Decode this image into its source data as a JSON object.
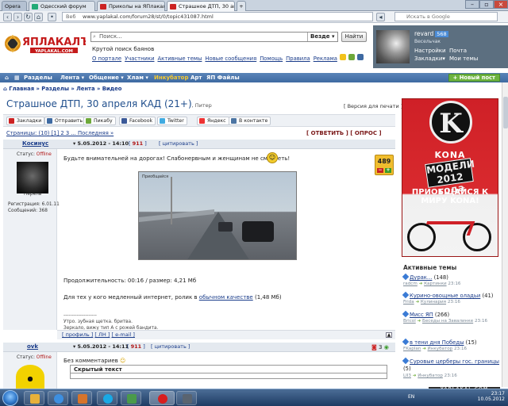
{
  "browser": {
    "tabs": [
      {
        "label": "Opera",
        "color": "#d22"
      },
      {
        "label": "Одесский форум",
        "color": "#2a7"
      },
      {
        "label": "Приколы на ЯПлакалъ",
        "color": "#c22"
      },
      {
        "label": "Страшное ДТП, 30 апреля К",
        "color": "#c22"
      }
    ],
    "address_prefix": "Веб",
    "url": "www.yaplakal.com/forum28/st/0/topic431087.html",
    "search_placeholder": "Искать в Google"
  },
  "header": {
    "logo_text": "ЯПЛАКАЛЪ",
    "logo_sub": "YAPLAKAL.COM",
    "search_placeholder": "Поиск...",
    "search_scope": "Везде",
    "search_button": "Найти",
    "tagline": "Крутой поиск баянов",
    "links": [
      "О портале",
      "Участники",
      "Активные темы",
      "Новые сообщения",
      "Помощь",
      "Правила",
      "Реклама"
    ]
  },
  "user": {
    "name": "revard",
    "score": "568",
    "role": "Весельчак",
    "links": [
      "Настройки",
      "Почта",
      "Закладки",
      "Мои темы"
    ]
  },
  "nav": {
    "items": [
      "Разделы",
      "Лента",
      "Общение",
      "Хлам",
      "Инкубатор",
      "Арт",
      "ЯП Файлы"
    ],
    "new_post": "Новый пост"
  },
  "breadcrumb": [
    "Главная",
    "Разделы",
    "Лента",
    "Видео"
  ],
  "topic": {
    "title": "Страшное ДТП, 30 апреля КАД (21+)",
    "subtitle": ", Питер",
    "print_version": "[ Версия для печати ]",
    "share": [
      "Закладки",
      "Отправить",
      "Пикабу",
      "Facebook",
      "Twitter",
      "Яндекс",
      "В контакте"
    ],
    "pages_label": "Страницы: (10) [1] 2 3 ... Последняя »",
    "pages_links": "[ ОТВЕТИТЬ ] [ ОПРОС ]"
  },
  "post1": {
    "author": "Косинус",
    "date": "5.05.2012 - 14:10",
    "id": "911",
    "quote": "[ цитировать ]",
    "status_label": "Статус:",
    "status": "Offline",
    "user_title": "Перель",
    "reg": "Регистрация: 6.01.11",
    "msgs": "Сообщений: 368",
    "text": "Будьте внимательней на дорогах! Слабонервным и женщинам не смотреть!",
    "rating": "489",
    "video_stamp": "Приобщайся",
    "video_info": "Продолжительность: 00:16 / размер: 4,21 Мб",
    "slow_prefix": "Для тех у кого медленный интернет, ролик в ",
    "slow_link": "обычном качестве",
    "slow_suffix": " (1,48 Мб)",
    "sig_line1": "--------------------",
    "sig_line2": "Утро. зубная щетка. бритва.",
    "sig_line3": "Зеркало, вижу тип А с рожей бандита.",
    "footer": [
      "[ профиль ]",
      "[ ЛН ]",
      "[ e-mail ]"
    ]
  },
  "post2": {
    "author": "ovk",
    "date": "5.05.2012 - 14:11",
    "id": "911",
    "quote": "[ цитировать ]",
    "status_label": "Статус:",
    "status": "Offline",
    "text": "Без комментариев",
    "spoiler": "Скрытый текст",
    "count": "3"
  },
  "ad": {
    "brand": "KONA",
    "year": "МОДЕЛИ 2012 года",
    "slogan": "ПРИОБЩАЙСЯ К МИРУ KONA!"
  },
  "active_topics": {
    "title": "Активные темы",
    "items": [
      {
        "name": "Дурак...",
        "count": "(148)",
        "from": "radcm",
        "to": "Картинки",
        "time": "23:16"
      },
      {
        "name": "Курино-овощные оладьи",
        "count": "(41)",
        "from": "Frida",
        "to": "Кулинария",
        "time": "23:16"
      },
      {
        "name": "Мисс ЯП",
        "count": "(266)",
        "from": "Bricol",
        "to": "Беседы на Завалинке",
        "time": "23:16"
      },
      {
        "name": "в тени дня Победы",
        "count": "(15)",
        "from": "FKaplan",
        "to": "Инкубатор",
        "time": "23:16"
      },
      {
        "name": "Суровые церберы гос. границы",
        "count": "(5)",
        "from": "LII3",
        "to": "Инкубатор",
        "time": "23:16"
      }
    ]
  },
  "watermark": "YAPLAKAL.COM",
  "taskbar": {
    "lang": "EN",
    "time": "23:17",
    "date": "10.05.2012"
  }
}
